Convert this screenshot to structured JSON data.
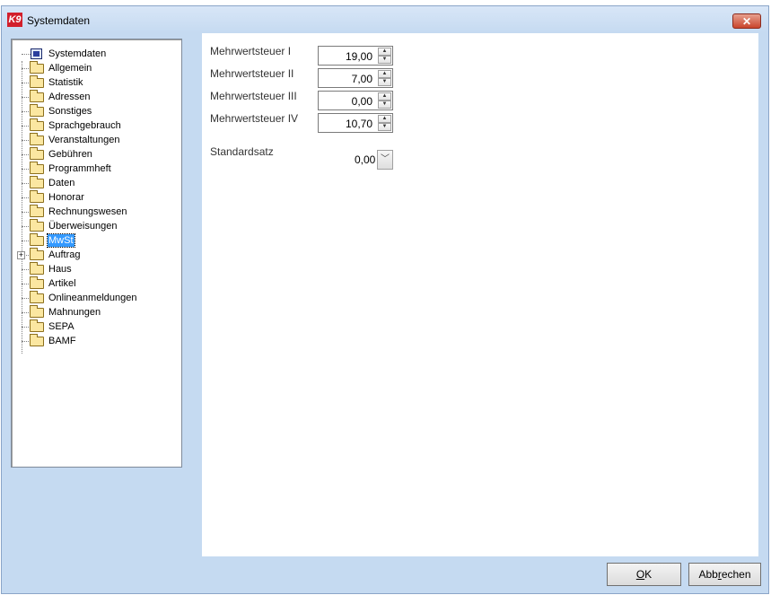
{
  "window": {
    "title": "Systemdaten",
    "app_icon_text": "K9"
  },
  "tree": {
    "root": "Systemdaten",
    "items": [
      {
        "label": "Allgemein"
      },
      {
        "label": "Statistik"
      },
      {
        "label": "Adressen"
      },
      {
        "label": "Sonstiges"
      },
      {
        "label": "Sprachgebrauch"
      },
      {
        "label": "Veranstaltungen"
      },
      {
        "label": "Gebühren"
      },
      {
        "label": "Programmheft"
      },
      {
        "label": "Daten"
      },
      {
        "label": "Honorar"
      },
      {
        "label": "Rechnungswesen"
      },
      {
        "label": "Überweisungen"
      },
      {
        "label": "MwSt",
        "selected": true
      },
      {
        "label": "Auftrag",
        "expandable": true,
        "expander": "+"
      },
      {
        "label": "Haus"
      },
      {
        "label": "Artikel"
      },
      {
        "label": "Onlineanmeldungen"
      },
      {
        "label": "Mahnungen"
      },
      {
        "label": "SEPA"
      },
      {
        "label": "BAMF"
      }
    ]
  },
  "mwst": {
    "fields": [
      {
        "label": "Mehrwertsteuer I",
        "value": "19,00"
      },
      {
        "label": "Mehrwertsteuer II",
        "value": "7,00"
      },
      {
        "label": "Mehrwertsteuer III",
        "value": "0,00"
      },
      {
        "label": "Mehrwertsteuer IV",
        "value": "10,70"
      }
    ],
    "standard_label": "Standardsatz",
    "standard_value": "0,00"
  },
  "buttons": {
    "ok_label": "OK",
    "ok_underline": "O",
    "ok_rest": "K",
    "cancel_label": "Abbrechen",
    "cancel_pre": "Abb",
    "cancel_underline": "r",
    "cancel_post": "echen"
  },
  "icons": {
    "close": "close-icon",
    "spin_up": "spin-up-icon",
    "spin_down": "spin-down-icon",
    "dropdown": "chevron-down-icon",
    "folder": "folder-icon"
  },
  "colors": {
    "window_bg": "#c5daf1",
    "selection": "#3399ff",
    "close_button": "#c9452c",
    "app_icon": "#d21f2b"
  }
}
